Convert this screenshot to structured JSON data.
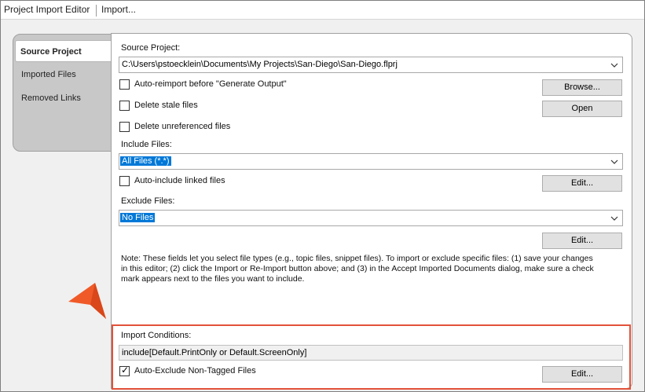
{
  "window": {
    "title": "Project Import Editor",
    "menu_import": "Import..."
  },
  "tabs": [
    {
      "label": "Source Project",
      "active": true
    },
    {
      "label": "Imported Files",
      "active": false
    },
    {
      "label": "Removed Links",
      "active": false
    }
  ],
  "source": {
    "label": "Source Project:",
    "path": "C:\\Users\\pstoecklein\\Documents\\My Projects\\San-Diego\\San-Diego.flprj",
    "auto_reimport": {
      "label": "Auto-reimport before \"Generate Output\"",
      "checked": false
    },
    "delete_stale": {
      "label": "Delete stale files",
      "checked": false
    },
    "delete_unreferenced": {
      "label": "Delete unreferenced files",
      "checked": false
    },
    "browse_label": "Browse...",
    "open_label": "Open"
  },
  "include": {
    "label": "Include Files:",
    "value": "All Files (*.*)",
    "auto_include_linked": {
      "label": "Auto-include linked files",
      "checked": false
    },
    "edit_label": "Edit..."
  },
  "exclude": {
    "label": "Exclude Files:",
    "value": "No Files",
    "edit_label": "Edit..."
  },
  "note": {
    "line1": "Note: These fields let you select file types (e.g., topic files, snippet files). To import or exclude specific files: (1) save your changes",
    "line2": "in this editor; (2) click the Import or Re-Import button above; and (3) in the Accept Imported Documents dialog, make sure a check",
    "line3": "mark appears next to the files you want to include."
  },
  "conditions": {
    "label": "Import Conditions:",
    "value": "include[Default.PrintOnly or Default.ScreenOnly]",
    "auto_exclude": {
      "label": "Auto-Exclude Non-Tagged Files",
      "checked": true
    },
    "edit_label": "Edit..."
  },
  "colors": {
    "highlight_border": "#e2523a",
    "pointer": "#f05a28",
    "selection": "#0078d7"
  }
}
